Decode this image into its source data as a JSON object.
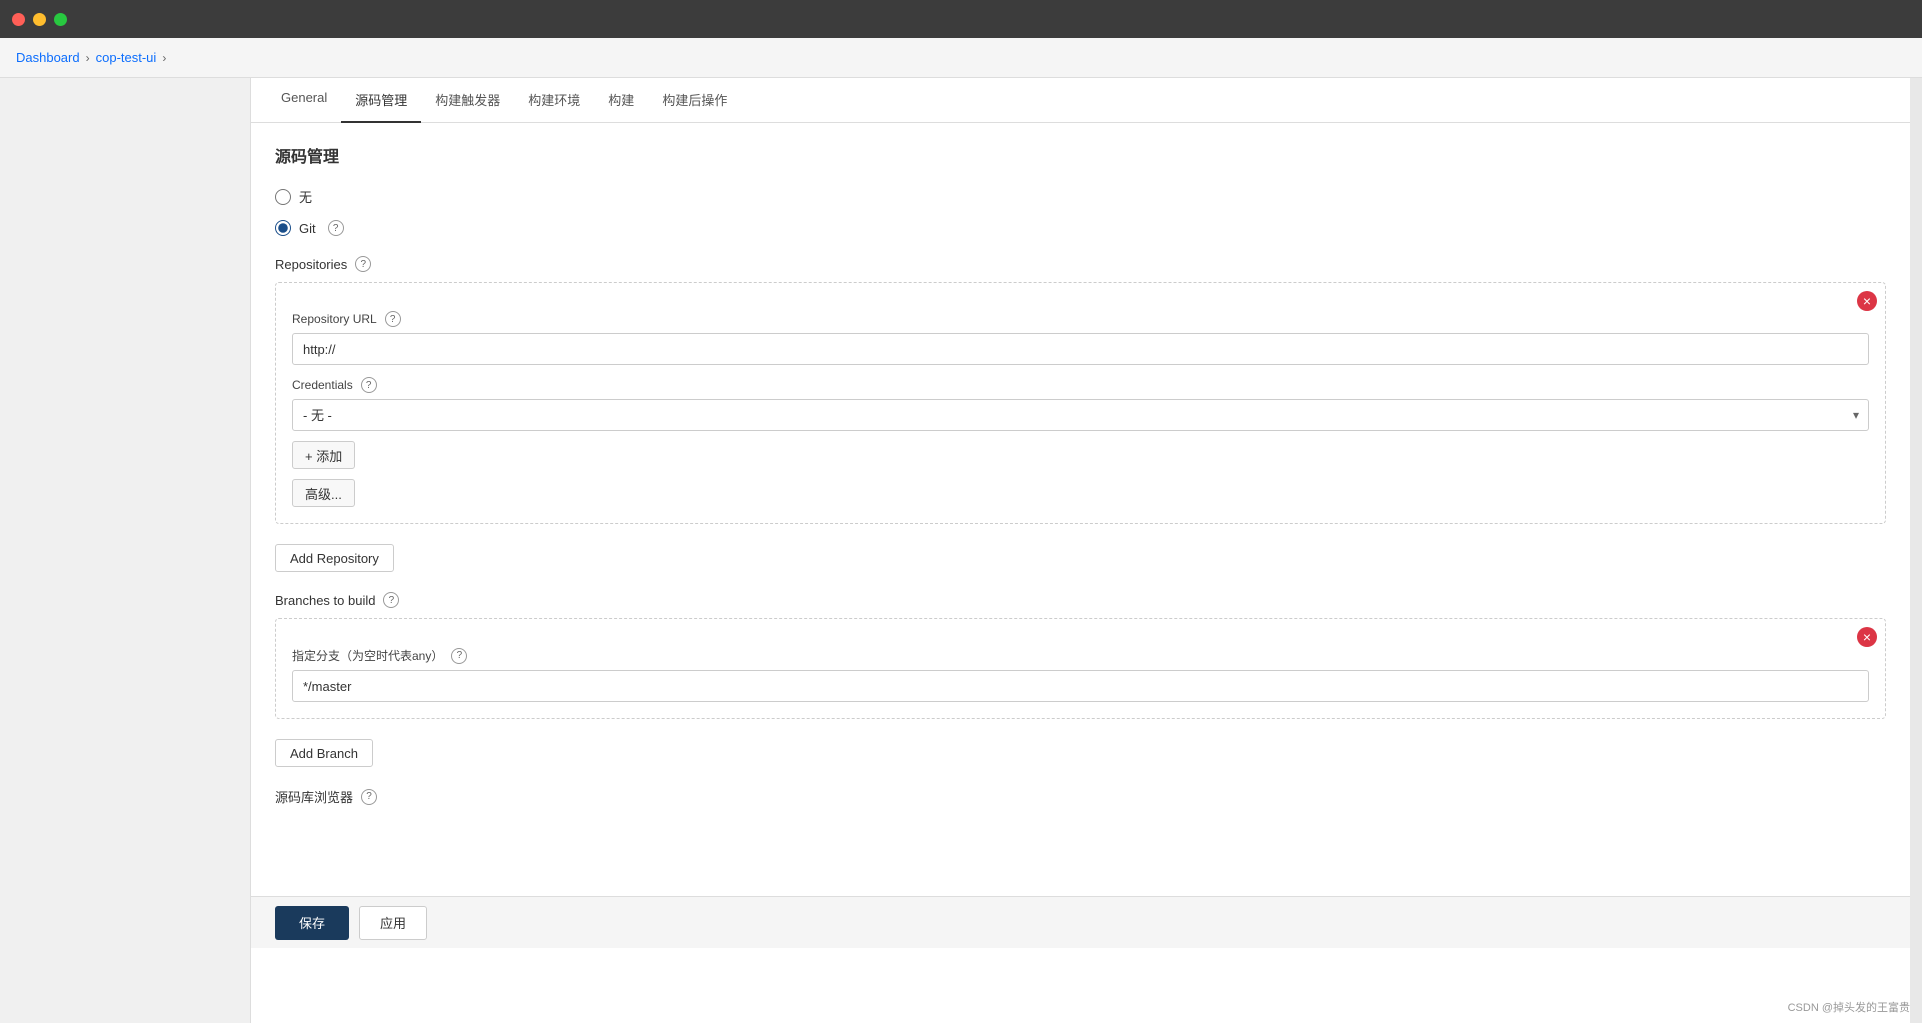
{
  "titlebar": {
    "traffic_lights": [
      "red",
      "yellow",
      "green"
    ]
  },
  "breadcrumb": {
    "items": [
      "Dashboard",
      "cop-test-ui"
    ],
    "separators": [
      ">",
      ">"
    ]
  },
  "tabs": [
    {
      "label": "General",
      "active": false
    },
    {
      "label": "源码管理",
      "active": true
    },
    {
      "label": "构建触发器",
      "active": false
    },
    {
      "label": "构建环境",
      "active": false
    },
    {
      "label": "构建",
      "active": false
    },
    {
      "label": "构建后操作",
      "active": false
    }
  ],
  "page": {
    "section_title": "源码管理",
    "none_option": "无",
    "git_option": "Git",
    "help_icon": "?",
    "repositories_label": "Repositories",
    "repository_url_label": "Repository URL",
    "repository_url_placeholder": "http://",
    "repository_url_value": "http://",
    "credentials_label": "Credentials",
    "credentials_prefix": "- 无 -",
    "add_label": "+ 添加",
    "advanced_label": "高级...",
    "add_repository_label": "Add Repository",
    "remove_icon": "×",
    "branches_label": "Branches to build",
    "branch_specifier_label": "指定分支（为空时代表any）",
    "branch_specifier_value": "*/master",
    "add_branch_label": "Add Branch",
    "source_browser_label": "源码库浏览器",
    "save_label": "保存",
    "apply_label": "应用",
    "watermark": "CSDN @掉头发的王富贵"
  }
}
